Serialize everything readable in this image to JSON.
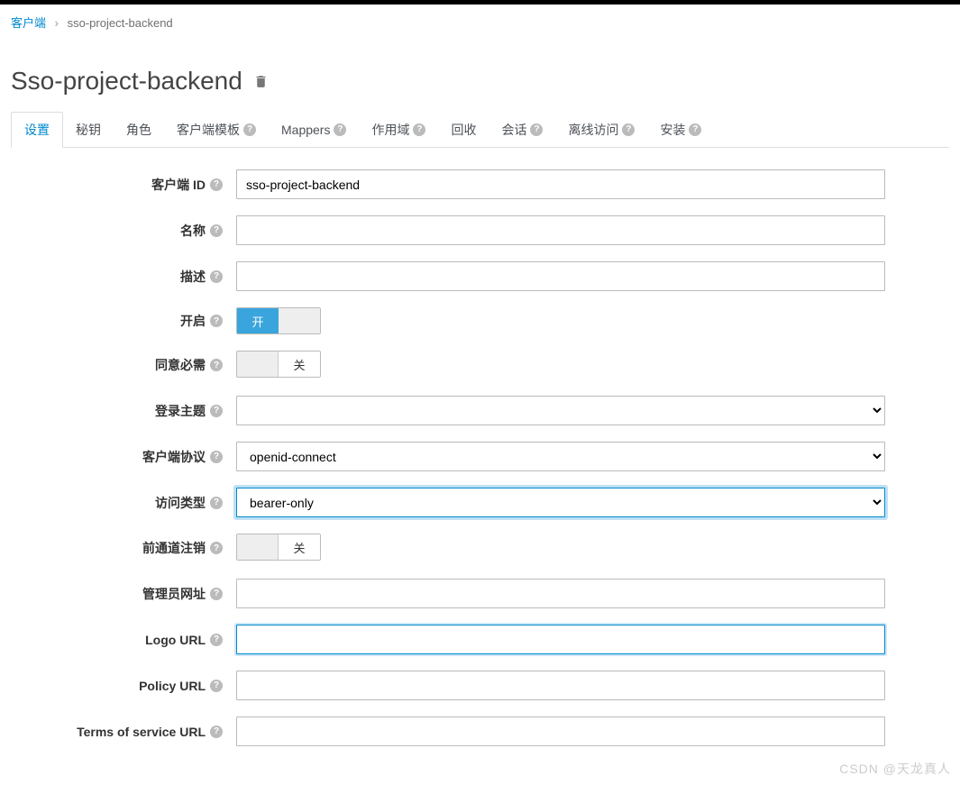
{
  "breadcrumb": {
    "root": "客户端",
    "current": "sso-project-backend"
  },
  "page_title": "Sso-project-backend",
  "tabs": [
    {
      "label": "设置",
      "active": true,
      "help": false
    },
    {
      "label": "秘钥",
      "active": false,
      "help": false
    },
    {
      "label": "角色",
      "active": false,
      "help": false
    },
    {
      "label": "客户端模板",
      "active": false,
      "help": true
    },
    {
      "label": "Mappers",
      "active": false,
      "help": true
    },
    {
      "label": "作用域",
      "active": false,
      "help": true
    },
    {
      "label": "回收",
      "active": false,
      "help": false
    },
    {
      "label": "会话",
      "active": false,
      "help": true
    },
    {
      "label": "离线访问",
      "active": false,
      "help": true
    },
    {
      "label": "安装",
      "active": false,
      "help": true
    }
  ],
  "form": {
    "client_id": {
      "label": "客户端 ID",
      "value": "sso-project-backend"
    },
    "name": {
      "label": "名称",
      "value": ""
    },
    "description": {
      "label": "描述",
      "value": ""
    },
    "enabled": {
      "label": "开启",
      "on_text": "开"
    },
    "consent_required": {
      "label": "同意必需",
      "off_text": "关"
    },
    "login_theme": {
      "label": "登录主题",
      "value": ""
    },
    "client_protocol": {
      "label": "客户端协议",
      "value": "openid-connect"
    },
    "access_type": {
      "label": "访问类型",
      "value": "bearer-only"
    },
    "front_channel_logout": {
      "label": "前通道注销",
      "off_text": "关"
    },
    "admin_url": {
      "label": "管理员网址",
      "value": ""
    },
    "logo_url": {
      "label": "Logo URL",
      "value": ""
    },
    "policy_url": {
      "label": "Policy URL",
      "value": ""
    },
    "tos_url": {
      "label": "Terms of service URL",
      "value": ""
    }
  },
  "watermark": "CSDN @天龙真人"
}
